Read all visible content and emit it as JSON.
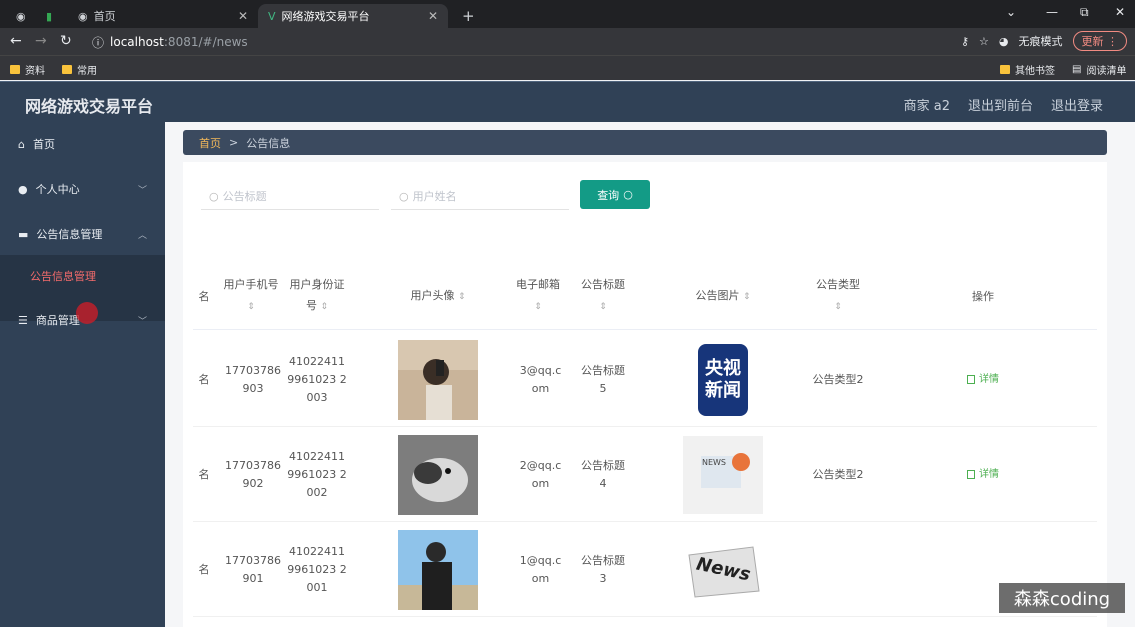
{
  "browser": {
    "tabs": [
      {
        "label": ""
      },
      {
        "label": "首页"
      },
      {
        "label": "网络游戏交易平台"
      }
    ],
    "url_host": "localhost",
    "url_path": ":8081/#/news",
    "incognito_label": "无痕模式",
    "update_label": "更新",
    "bookmarks": [
      "资料",
      "常用"
    ],
    "bookmarks_right": [
      "其他书签",
      "阅读清单"
    ]
  },
  "app": {
    "title": "网络游戏交易平台",
    "header_links": [
      "商家 a2",
      "退出到前台",
      "退出登录"
    ]
  },
  "sidebar": {
    "items": [
      {
        "label": "首页"
      },
      {
        "label": "个人中心"
      },
      {
        "label": "公告信息管理"
      },
      {
        "label": "商品管理"
      }
    ],
    "active_sub": "公告信息管理"
  },
  "breadcrumb": {
    "home": "首页",
    "sep": ">",
    "current": "公告信息"
  },
  "search": {
    "title_placeholder": "公告标题",
    "user_placeholder": "用户姓名",
    "query_label": "查询"
  },
  "table": {
    "headers": {
      "name_tail": "名",
      "phone": "用户手机号",
      "idcard": "用户身份证号",
      "avatar": "用户头像",
      "email": "电子邮箱",
      "title": "公告标题",
      "image": "公告图片",
      "type": "公告类型",
      "action": "操作"
    },
    "rows": [
      {
        "name_tail": "名",
        "phone": "17703786903",
        "idcard": "410224119961023 2003",
        "email": "3@qq.com",
        "title": "公告标题5",
        "image_text": "央视新闻",
        "type": "公告类型2",
        "action": "详情"
      },
      {
        "name_tail": "名",
        "phone": "17703786902",
        "idcard": "410224119961023 2002",
        "email": "2@qq.com",
        "title": "公告标题4",
        "image_text": "NEWS",
        "type": "公告类型2",
        "action": "详情"
      },
      {
        "name_tail": "名",
        "phone": "17703786901",
        "idcard": "410224119961023 2001",
        "email": "1@qq.com",
        "title": "公告标题3",
        "image_text": "News",
        "type": "",
        "action": ""
      }
    ]
  },
  "watermark": "森森coding"
}
